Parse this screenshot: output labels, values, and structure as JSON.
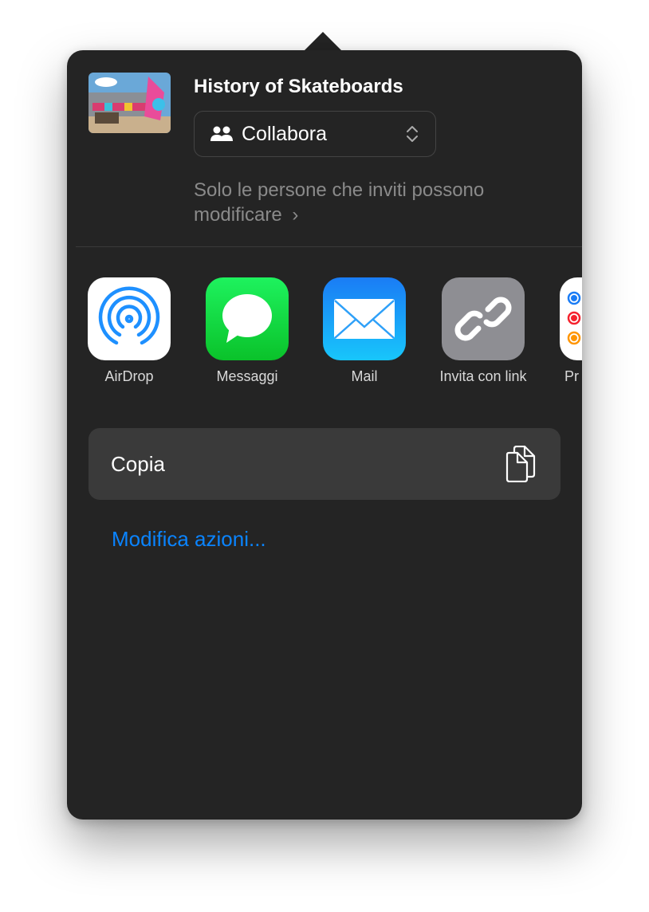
{
  "document": {
    "title": "History of Skateboards",
    "thumbnail_icon": "skateboards-thumbnail"
  },
  "dropdown": {
    "icon": "people-icon",
    "value": "Collabora"
  },
  "permission": {
    "text": "Solo le persone che inviti possono modificare",
    "chevron": "›"
  },
  "apps": [
    {
      "label": "AirDrop",
      "icon": "airdrop-icon"
    },
    {
      "label": "Messaggi",
      "icon": "messages-icon"
    },
    {
      "label": "Mail",
      "icon": "mail-icon"
    },
    {
      "label": "Invita con link",
      "icon": "link-icon"
    },
    {
      "label": "Pr",
      "icon": "reminders-icon"
    }
  ],
  "actions": {
    "copy_label": "Copia",
    "edit_label": "Modifica azioni..."
  },
  "colors": {
    "background": "#242424",
    "accent": "#0a84ff",
    "button": "#3a3a3a"
  }
}
